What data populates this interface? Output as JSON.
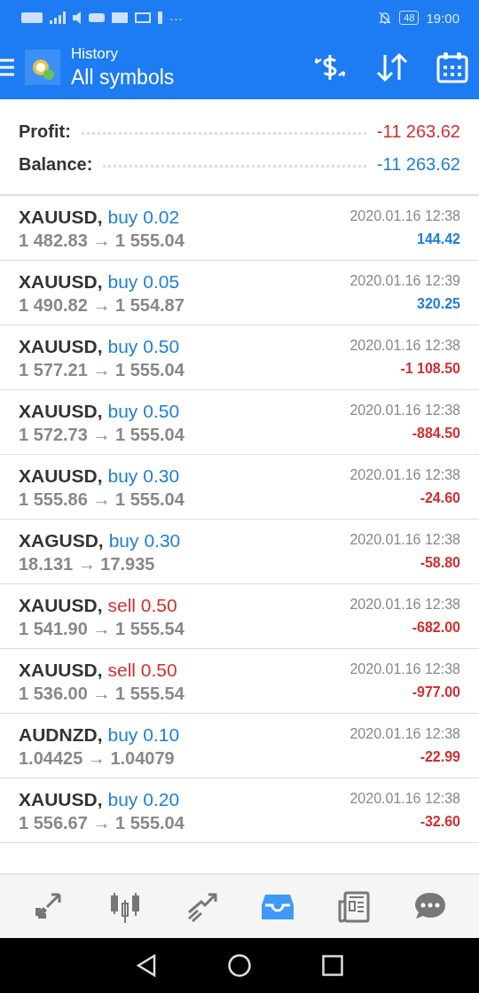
{
  "status_bar": {
    "battery": "48",
    "time": "19:00",
    "overflow": "···"
  },
  "header": {
    "title": "History",
    "subtitle": "All symbols"
  },
  "summary": [
    {
      "label": "Profit:",
      "value": "-11 263.62",
      "color": "#d32f2f"
    },
    {
      "label": "Balance:",
      "value": "-11 263.62",
      "color": "#1e7fd6"
    }
  ],
  "deals": [
    {
      "symbol": "XAUUSD,",
      "kind": "buy",
      "order": "buy 0.02",
      "prices": "1 482.83 → 1 555.04",
      "time": "2020.01.16 12:38",
      "profit": "144.42",
      "color": "#1e7fd6"
    },
    {
      "symbol": "XAUUSD,",
      "kind": "buy",
      "order": "buy 0.05",
      "prices": "1 490.82 → 1 554.87",
      "time": "2020.01.16 12:39",
      "profit": "320.25",
      "color": "#1e7fd6"
    },
    {
      "symbol": "XAUUSD,",
      "kind": "buy",
      "order": "buy 0.50",
      "prices": "1 577.21 → 1 555.04",
      "time": "2020.01.16 12:38",
      "profit": "-1 108.50",
      "color": "#d32f2f"
    },
    {
      "symbol": "XAUUSD,",
      "kind": "buy",
      "order": "buy 0.50",
      "prices": "1 572.73 → 1 555.04",
      "time": "2020.01.16 12:38",
      "profit": "-884.50",
      "color": "#d32f2f"
    },
    {
      "symbol": "XAUUSD,",
      "kind": "buy",
      "order": "buy 0.30",
      "prices": "1 555.86 → 1 555.04",
      "time": "2020.01.16 12:38",
      "profit": "-24.60",
      "color": "#d32f2f"
    },
    {
      "symbol": "XAGUSD,",
      "kind": "buy",
      "order": "buy 0.30",
      "prices": "18.131 → 17.935",
      "time": "2020.01.16 12:38",
      "profit": "-58.80",
      "color": "#d32f2f"
    },
    {
      "symbol": "XAUUSD,",
      "kind": "sell",
      "order": "sell 0.50",
      "prices": "1 541.90 → 1 555.54",
      "time": "2020.01.16 12:38",
      "profit": "-682.00",
      "color": "#d32f2f"
    },
    {
      "symbol": "XAUUSD,",
      "kind": "sell",
      "order": "sell 0.50",
      "prices": "1 536.00 → 1 555.54",
      "time": "2020.01.16 12:38",
      "profit": "-977.00",
      "color": "#d32f2f"
    },
    {
      "symbol": "AUDNZD,",
      "kind": "buy",
      "order": "buy 0.10",
      "prices": "1.04425 → 1.04079",
      "time": "2020.01.16 12:38",
      "profit": "-22.99",
      "color": "#d32f2f"
    },
    {
      "symbol": "XAUUSD,",
      "kind": "buy",
      "order": "buy 0.20",
      "prices": "1 556.67 → 1 555.04",
      "time": "2020.01.16 12:38",
      "profit": "-32.60",
      "color": "#d32f2f"
    }
  ],
  "bottom_nav": [
    {
      "kind": "quotes",
      "selected": false
    },
    {
      "kind": "chart",
      "selected": false
    },
    {
      "kind": "trade",
      "selected": false
    },
    {
      "kind": "history",
      "selected": true
    },
    {
      "kind": "news",
      "selected": false
    },
    {
      "kind": "chat",
      "selected": false
    }
  ]
}
